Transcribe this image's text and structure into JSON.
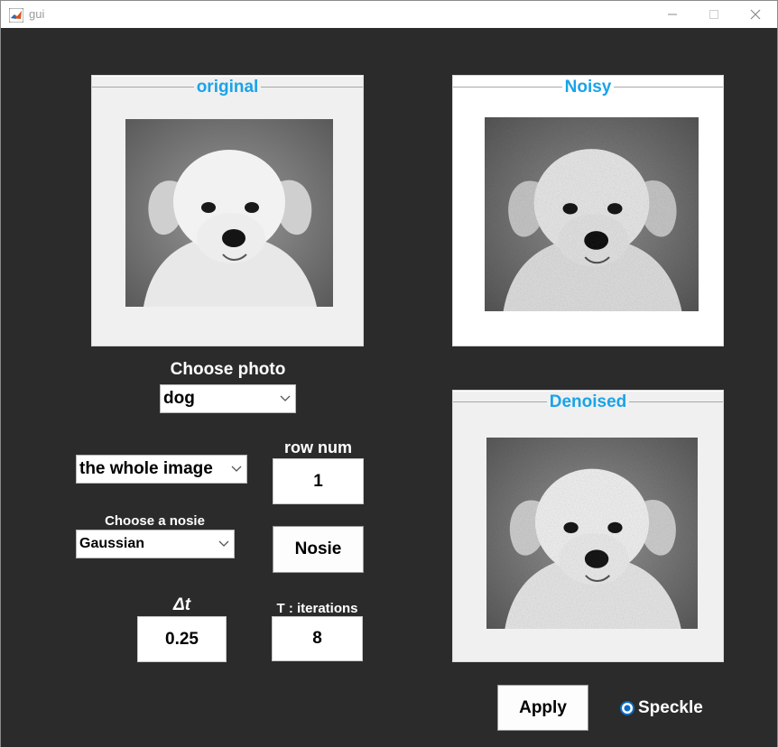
{
  "window": {
    "title": "gui"
  },
  "panels": {
    "original": {
      "title": "original"
    },
    "noisy": {
      "title": "Noisy"
    },
    "denoised": {
      "title": "Denoised"
    }
  },
  "choose_photo": {
    "label": "Choose photo",
    "selected": "dog"
  },
  "region": {
    "selected": "the whole image"
  },
  "row_num": {
    "label": "row num",
    "value": "1"
  },
  "noise": {
    "label": "Choose a nosie",
    "selected": "Gaussian",
    "button": "Nosie"
  },
  "dt": {
    "label": "Δt",
    "value": "0.25"
  },
  "iterations": {
    "label": "T : iterations",
    "value": "8"
  },
  "apply": {
    "label": "Apply"
  },
  "speckle": {
    "label": "Speckle",
    "selected": true
  },
  "colors": {
    "background": "#2b2b2b",
    "panel_title": "#1aa3e8",
    "radio": "#0a6cc4"
  }
}
